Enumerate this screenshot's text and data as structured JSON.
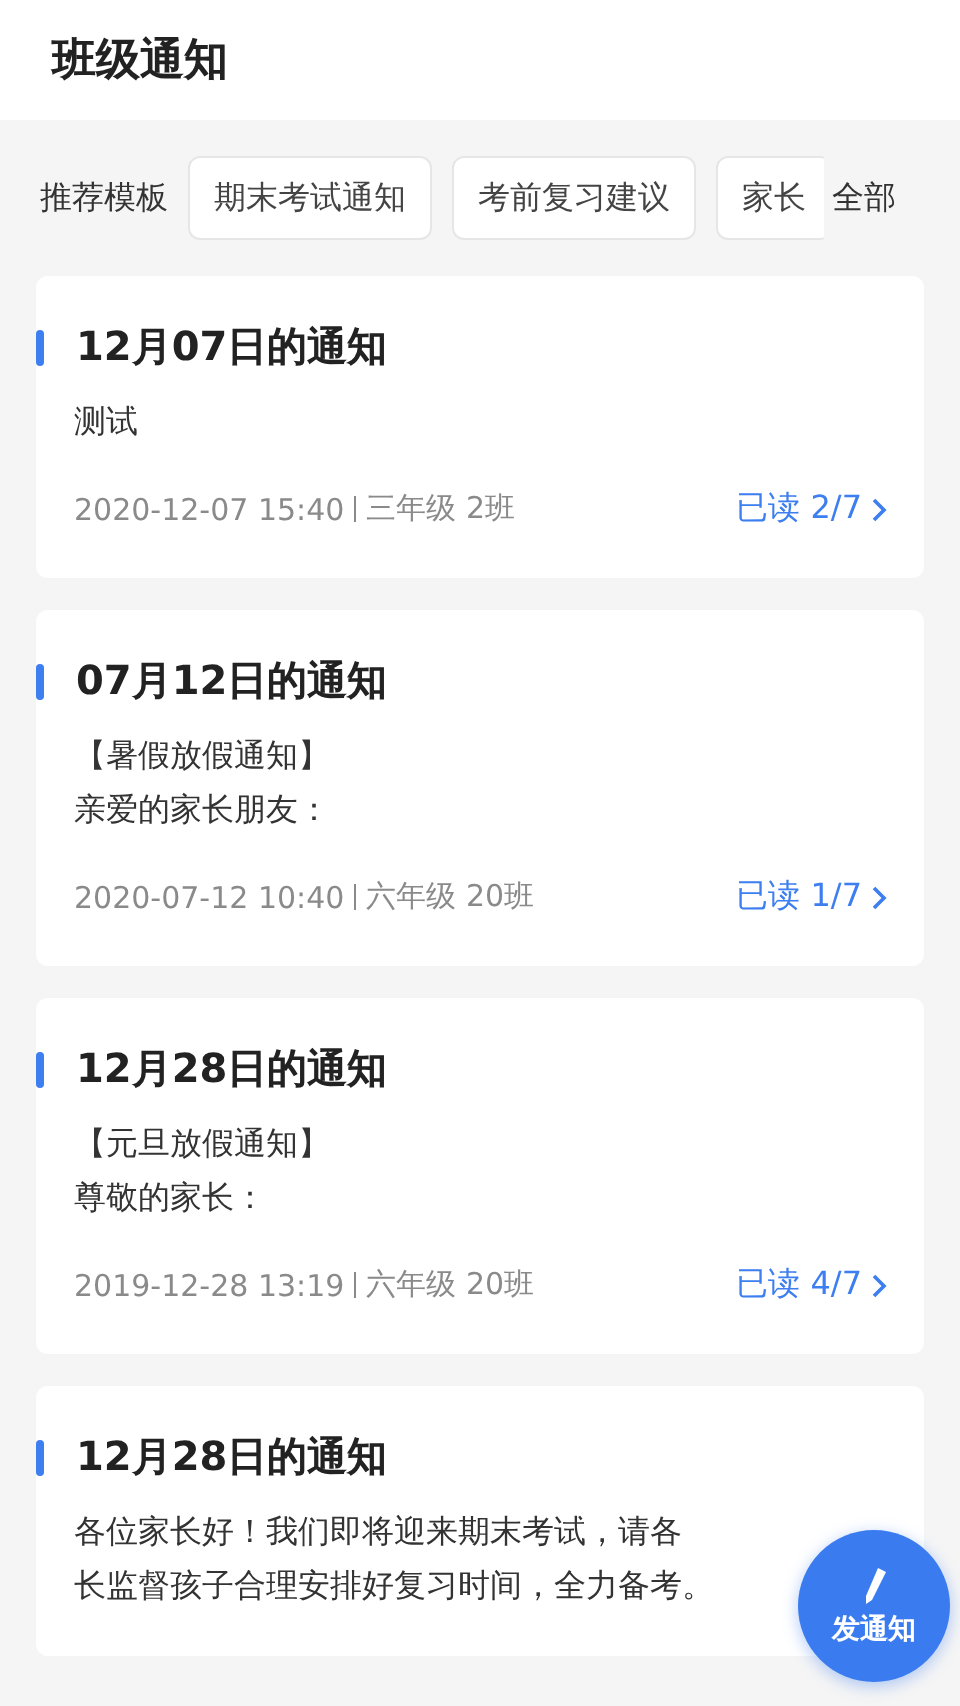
{
  "header": {
    "title": "班级通知"
  },
  "templates": {
    "label": "推荐模板",
    "chips": [
      "期末考试通知",
      "考前复习建议",
      "家长"
    ],
    "all_link": "全部"
  },
  "notices": [
    {
      "title": "12月07日的通知",
      "body": [
        "测试"
      ],
      "time": "2020-12-07 15:40",
      "class_name": "三年级 2班",
      "read": "已读 2/7"
    },
    {
      "title": "07月12日的通知",
      "body": [
        "【暑假放假通知】",
        "亲爱的家长朋友："
      ],
      "time": "2020-07-12 10:40",
      "class_name": "六年级 20班",
      "read": "已读 1/7"
    },
    {
      "title": "12月28日的通知",
      "body": [
        "【元旦放假通知】",
        "尊敬的家长："
      ],
      "time": "2019-12-28 13:19",
      "class_name": "六年级 20班",
      "read": "已读 4/7"
    },
    {
      "title": "12月28日的通知",
      "body": [
        "各位家长好！我们即将迎来期末考试，请各",
        "长监督孩子合理安排好复习时间，全力备考。"
      ]
    }
  ],
  "fab": {
    "label": "发通知"
  }
}
